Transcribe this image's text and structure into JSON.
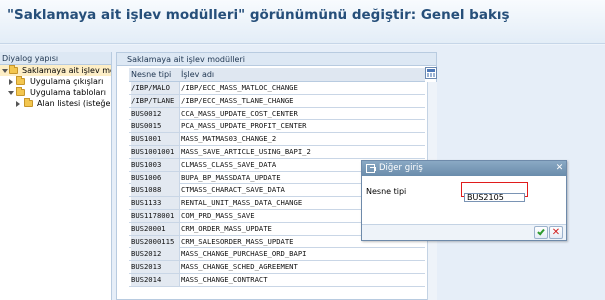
{
  "window": {
    "title": "\"Saklamaya ait işlev modülleri\" görünümünü değiştir: Genel bakış"
  },
  "tree": {
    "header": "Diyalog yapısı",
    "items": [
      {
        "label": "Saklamaya ait işlev modü",
        "expanded": true,
        "selected": true
      },
      {
        "label": "Uygulama çıkışları",
        "expanded": false,
        "selected": false
      },
      {
        "label": "Uygulama tabloları",
        "expanded": true,
        "selected": false
      },
      {
        "label": "Alan listesi (isteğe",
        "expanded": false,
        "selected": false
      }
    ]
  },
  "panel": {
    "header": "Saklamaya ait işlev modülleri",
    "columns": [
      "Nesne tipi",
      "İşlev adı"
    ],
    "rows": [
      [
        "/IBP/MALO",
        "/IBP/ECC_MASS_MATLOC_CHANGE"
      ],
      [
        "/IBP/TLANE",
        "/IBP/ECC_MASS_TLANE_CHANGE"
      ],
      [
        "BUS0012",
        "CCA_MASS_UPDATE_COST_CENTER"
      ],
      [
        "BUS0015",
        "PCA_MASS_UPDATE_PROFIT_CENTER"
      ],
      [
        "BUS1001",
        "MASS_MATMAS03_CHANGE_2"
      ],
      [
        "BUS1001001",
        "MASS_SAVE_ARTICLE_USING_BAPI_2"
      ],
      [
        "BUS1003",
        "CLMASS_CLASS_SAVE_DATA"
      ],
      [
        "BUS1006",
        "BUPA_BP_MASSDATA_UPDATE"
      ],
      [
        "BUS1088",
        "CTMASS_CHARACT_SAVE_DATA"
      ],
      [
        "BUS1133",
        "RENTAL_UNIT_MASS_DATA_CHANGE"
      ],
      [
        "BUS1178001",
        "COM_PRD_MASS_SAVE"
      ],
      [
        "BUS20001",
        "CRM_ORDER_MASS_UPDATE"
      ],
      [
        "BUS2000115",
        "CRM_SALESORDER_MASS_UPDATE"
      ],
      [
        "BUS2012",
        "MASS_CHANGE_PURCHASE_ORD_BAPI"
      ],
      [
        "BUS2013",
        "MASS_CHANGE_SCHED_AGREEMENT"
      ],
      [
        "BUS2014",
        "MASS_CHANGE_CONTRACT"
      ]
    ]
  },
  "dialog": {
    "title": "Diğer giriş",
    "field_label": "Nesne tipi",
    "field_value": "BUS2105",
    "ok_icon": "check-icon",
    "cancel_icon": "x-icon"
  },
  "colors": {
    "title_text": "#264f7a",
    "highlight_border": "#e01c1c",
    "ok_green": "#2e9a2e",
    "cancel_red": "#d11f1f"
  }
}
